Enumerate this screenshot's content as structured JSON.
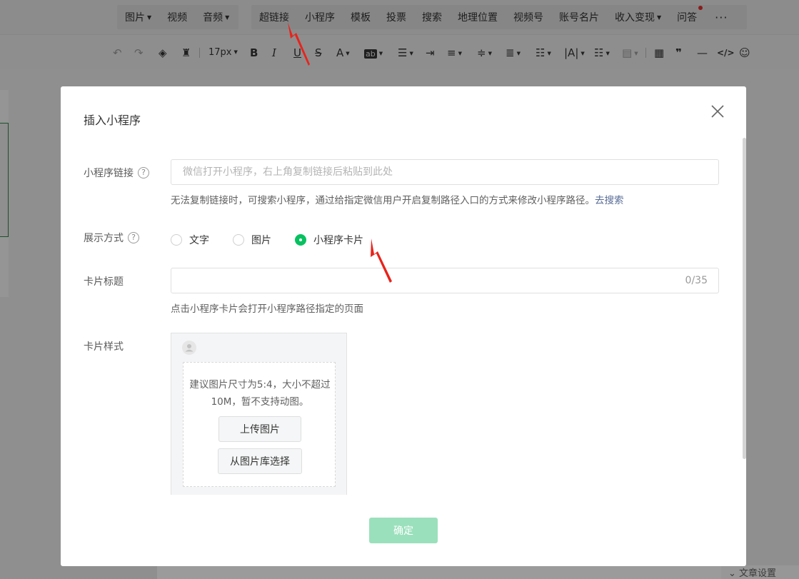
{
  "menubar": {
    "items": [
      {
        "label": "图片",
        "dropdown": true
      },
      {
        "label": "视频",
        "dropdown": false
      },
      {
        "label": "音频",
        "dropdown": true
      },
      {
        "label": "超链接",
        "dropdown": false
      },
      {
        "label": "小程序",
        "dropdown": false
      },
      {
        "label": "模板",
        "dropdown": false
      },
      {
        "label": "投票",
        "dropdown": false
      },
      {
        "label": "搜索",
        "dropdown": false
      },
      {
        "label": "地理位置",
        "dropdown": false
      },
      {
        "label": "视频号",
        "dropdown": false
      },
      {
        "label": "账号名片",
        "dropdown": false
      },
      {
        "label": "收入变现",
        "dropdown": true
      },
      {
        "label": "问答",
        "dropdown": false,
        "notification_dot": true
      }
    ],
    "more": "···"
  },
  "toolbar": {
    "font_size": "17px",
    "bold": "B",
    "italic": "I",
    "underline": "U",
    "strike": "S",
    "font_color": "A",
    "highlight": "ab",
    "quote": "❞",
    "code": "</>",
    "icons": [
      "undo-icon",
      "redo-icon",
      "format-painter-icon",
      "clear-format-icon",
      "align-icon",
      "indent-icon",
      "line-height-icon",
      "paragraph-spacing-icon",
      "list-icon",
      "table-icon",
      "divider-icon",
      "emoji-icon"
    ]
  },
  "editor": {
    "article_settings": "文章设置"
  },
  "dialog": {
    "title": "插入小程序",
    "link_label": "小程序链接",
    "link_placeholder": "微信打开小程序，右上角复制链接后粘贴到此处",
    "link_value": "",
    "link_tip": "无法复制链接时，可搜索小程序，通过给指定微信用户开启复制路径入口的方式来修改小程序路径。",
    "link_tip_action": "去搜索",
    "display_label": "展示方式",
    "display_options": [
      {
        "label": "文字",
        "checked": false
      },
      {
        "label": "图片",
        "checked": false
      },
      {
        "label": "小程序卡片",
        "checked": true
      }
    ],
    "card_title_label": "卡片标题",
    "card_title_value": "",
    "card_title_counter": "0/35",
    "card_title_tip": "点击小程序卡片会打开小程序路径指定的页面",
    "card_style_label": "卡片样式",
    "upload_hint": "建议图片尺寸为5:4，大小不超过10M，暂不支持动图。",
    "upload_button": "上传图片",
    "library_button": "从图片库选择",
    "confirm_button": "确定",
    "help_glyph": "?"
  },
  "colors": {
    "accent_green": "#07c160",
    "confirm_disabled": "#9be0bc",
    "link_blue": "#576b95",
    "annotation_red": "#e8231b"
  }
}
